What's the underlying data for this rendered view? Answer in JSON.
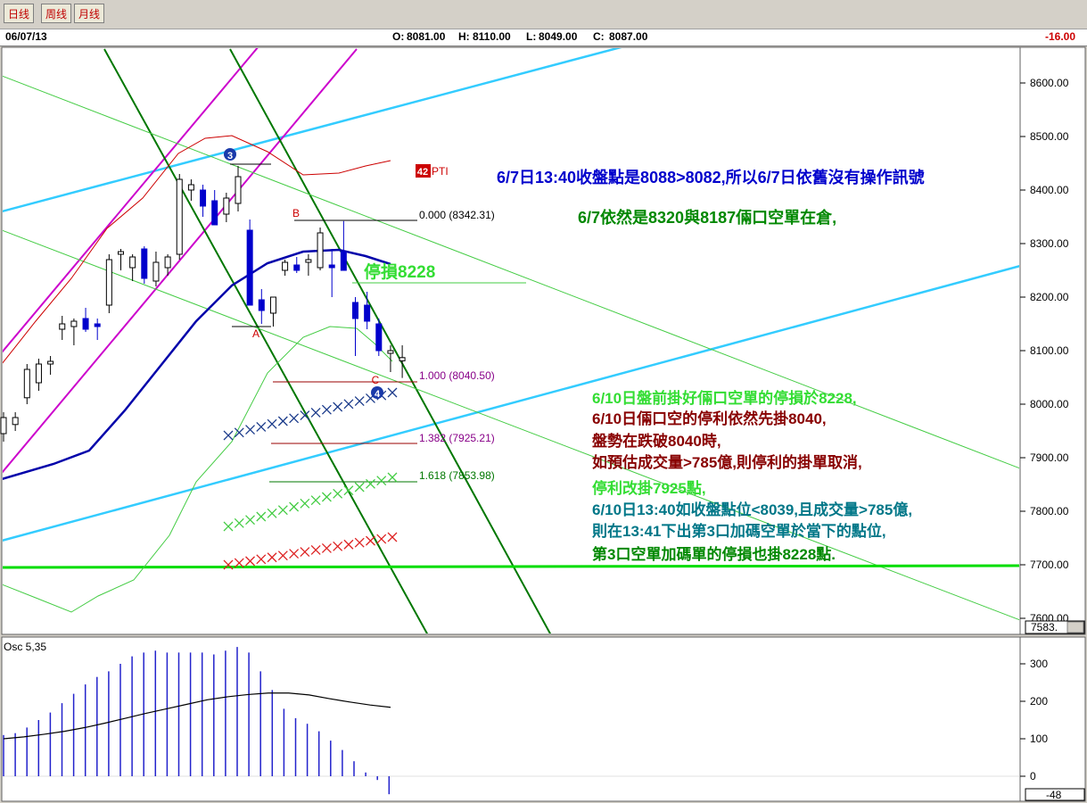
{
  "toolbar": {
    "buttons": [
      "日线",
      "周线",
      "月线"
    ]
  },
  "header": {
    "date": "06/07/13",
    "open_label": "O:",
    "open": "8081.00",
    "high_label": "H:",
    "high": "8110.00",
    "low_label": "L:",
    "low": "8049.00",
    "close_label": "C:",
    "close": "8087.00",
    "change": "-16.00"
  },
  "colors": {
    "up": "#000000",
    "down": "#0000cc",
    "channel": "#cc00cc",
    "trend": "#007700",
    "cyan": "#33ccff",
    "thin_green": "#44cc44",
    "ma_blue": "#0000aa",
    "ma_red": "#cc0000",
    "support": "#00dd00",
    "fib": "#990000",
    "annot_blue": "#0000cc",
    "annot_green": "#008800",
    "annot_bright": "#33dd33",
    "annot_red": "#880000",
    "annot_teal": "#007788"
  },
  "chart_data": [
    {
      "type": "candlestick",
      "title": "",
      "xlabel": "",
      "ylabel": "",
      "ylim": [
        7583,
        8680
      ],
      "y_ticks": [
        "8600.00",
        "8500.00",
        "8400.00",
        "8300.00",
        "8200.00",
        "8100.00",
        "8000.00",
        "7900.00",
        "7800.00",
        "7700.00",
        "7600.00"
      ],
      "last_value_label": "7583.",
      "candles": [
        {
          "o": 7945,
          "h": 7985,
          "l": 7930,
          "c": 7975
        },
        {
          "o": 7962,
          "h": 7985,
          "l": 7950,
          "c": 7975
        },
        {
          "o": 8012,
          "h": 8075,
          "l": 8000,
          "c": 8065
        },
        {
          "o": 8040,
          "h": 8085,
          "l": 8025,
          "c": 8075
        },
        {
          "o": 8075,
          "h": 8090,
          "l": 8055,
          "c": 8080
        },
        {
          "o": 8140,
          "h": 8165,
          "l": 8120,
          "c": 8150
        },
        {
          "o": 8145,
          "h": 8160,
          "l": 8110,
          "c": 8155
        },
        {
          "o": 8160,
          "h": 8180,
          "l": 8135,
          "c": 8140
        },
        {
          "o": 8150,
          "h": 8160,
          "l": 8120,
          "c": 8145
        },
        {
          "o": 8185,
          "h": 8280,
          "l": 8170,
          "c": 8270
        },
        {
          "o": 8280,
          "h": 8290,
          "l": 8250,
          "c": 8285
        },
        {
          "o": 8255,
          "h": 8280,
          "l": 8230,
          "c": 8275
        },
        {
          "o": 8290,
          "h": 8295,
          "l": 8225,
          "c": 8235
        },
        {
          "o": 8230,
          "h": 8285,
          "l": 8220,
          "c": 8265
        },
        {
          "o": 8255,
          "h": 8280,
          "l": 8240,
          "c": 8275
        },
        {
          "o": 8280,
          "h": 8430,
          "l": 8270,
          "c": 8420
        },
        {
          "o": 8400,
          "h": 8420,
          "l": 8380,
          "c": 8410
        },
        {
          "o": 8400,
          "h": 8410,
          "l": 8350,
          "c": 8370
        },
        {
          "o": 8380,
          "h": 8400,
          "l": 8340,
          "c": 8335
        },
        {
          "o": 8355,
          "h": 8395,
          "l": 8340,
          "c": 8385
        },
        {
          "o": 8375,
          "h": 8445,
          "l": 8360,
          "c": 8425
        },
        {
          "o": 8325,
          "h": 8345,
          "l": 8185,
          "c": 8185
        },
        {
          "o": 8195,
          "h": 8215,
          "l": 8150,
          "c": 8175
        },
        {
          "o": 8170,
          "h": 8195,
          "l": 8145,
          "c": 8200
        },
        {
          "o": 8250,
          "h": 8270,
          "l": 8240,
          "c": 8265
        },
        {
          "o": 8260,
          "h": 8275,
          "l": 8245,
          "c": 8250
        },
        {
          "o": 8265,
          "h": 8280,
          "l": 8240,
          "c": 8270
        },
        {
          "o": 8255,
          "h": 8330,
          "l": 8250,
          "c": 8320
        },
        {
          "o": 8260,
          "h": 8290,
          "l": 8200,
          "c": 8255
        },
        {
          "o": 8285,
          "h": 8342,
          "l": 8255,
          "c": 8250
        },
        {
          "o": 8190,
          "h": 8200,
          "l": 8090,
          "c": 8160
        },
        {
          "o": 8185,
          "h": 8210,
          "l": 8140,
          "c": 8155
        },
        {
          "o": 8150,
          "h": 8160,
          "l": 8090,
          "c": 8100
        },
        {
          "o": 8095,
          "h": 8110,
          "l": 8060,
          "c": 8100
        },
        {
          "o": 8081,
          "h": 8110,
          "l": 8049,
          "c": 8087
        }
      ],
      "overlay_labels": {
        "A": "A",
        "B": "B",
        "C": "C",
        "wave3": "3",
        "wave4": "4",
        "pti_number": "42",
        "pti_text": "PTI",
        "fib_0": "0.000 (8342.31)",
        "fib_1": "1.000 (8040.50)",
        "fib_1382": "1.382 (7925.21)",
        "fib_1618": "1.618 (7853.98)"
      }
    },
    {
      "type": "bar",
      "title": "Osc 5,35",
      "ylim": [
        -48,
        360
      ],
      "y_ticks": [
        "300",
        "200",
        "100",
        "0"
      ],
      "last_value_label": "-48",
      "values": [
        110,
        115,
        130,
        150,
        170,
        195,
        220,
        245,
        265,
        280,
        300,
        320,
        330,
        335,
        330,
        330,
        330,
        330,
        325,
        335,
        345,
        330,
        280,
        230,
        180,
        155,
        140,
        120,
        95,
        70,
        40,
        10,
        -10,
        -48
      ],
      "signal": [
        100,
        105,
        112,
        120,
        130,
        142,
        155,
        168,
        180,
        192,
        204,
        212,
        218,
        222,
        222,
        217,
        207,
        198,
        190,
        184
      ]
    }
  ],
  "annotations": {
    "stop_loss": "停損8228",
    "line1": "6/7日13:40收盤點是8088>8082,所以6/7日依舊沒有操作訊號",
    "line2": "6/7依然是8320與8187倆口空單在倉,",
    "p1": "6/10日盤前掛好倆口空單的停損於8228,",
    "p2": "6/10日倆口空的停利依然先掛8040,",
    "p3": "盤勢在跌破8040時,",
    "p4": "如預估成交量>785億,則停利的掛單取消,",
    "p5": "停利改掛7925點,",
    "p6": "6/10日13:40如收盤點位<8039,且成交量>785億,",
    "p7": "則在13:41下出第3口加碼空單於當下的點位,",
    "p8": "第3口空單加碼單的停損也掛8228點."
  }
}
